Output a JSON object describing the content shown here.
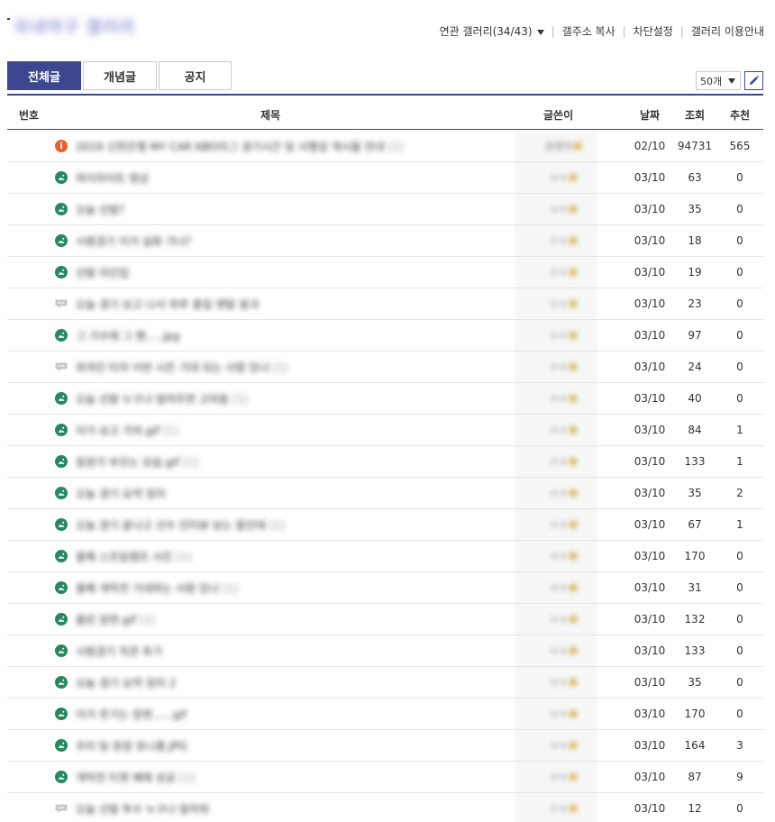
{
  "gallery": {
    "title": "국내야구 갤러리"
  },
  "top_links": {
    "related": "연관 갤러리(34/43)",
    "copy_address": "갤주소 복사",
    "block_settings": "차단설정",
    "guide": "갤러리 이용안내"
  },
  "tabs": [
    {
      "label": "전체글",
      "active": true
    },
    {
      "label": "개념글",
      "active": false
    },
    {
      "label": "공지",
      "active": false
    }
  ],
  "per_page": {
    "label": "50개"
  },
  "write_button": {
    "icon": "pencil-icon"
  },
  "columns": {
    "number": "번호",
    "title": "제목",
    "writer": "글쓴이",
    "date": "날짜",
    "views": "조회",
    "recommend": "추천"
  },
  "colors": {
    "accent": "#3b4890",
    "notice_icon": "#e8602c",
    "image_icon": "#27885e",
    "text_icon": "#c8c8c8"
  },
  "rows": [
    {
      "icon": "notice",
      "title": "2019 신한은행 MY CAR KBO리그 경기시간 및 사행성 게시물 안내",
      "tail": "[1]",
      "writer": "운영자",
      "date": "02/10",
      "views": "94731",
      "recommend": "565"
    },
    {
      "icon": "image",
      "title": "하이라이트 영상",
      "tail": "",
      "writer": "ㅇㅇ",
      "date": "03/10",
      "views": "63",
      "recommend": "0"
    },
    {
      "icon": "image",
      "title": "오늘 선발?",
      "tail": "",
      "writer": "ㅇㅇ",
      "date": "03/10",
      "views": "35",
      "recommend": "0"
    },
    {
      "icon": "image",
      "title": "시범경기 이거 실화 가냐?",
      "tail": "",
      "writer": "ㅇㅇ",
      "date": "03/10",
      "views": "18",
      "recommend": "0"
    },
    {
      "icon": "image",
      "title": "선발 라인업",
      "tail": "",
      "writer": "ㅇㅇ",
      "date": "03/10",
      "views": "19",
      "recommend": "0"
    },
    {
      "icon": "text",
      "title": "오늘 경기 보고 나서 하루 종일 멘탈 붕괴",
      "tail": "",
      "writer": "ㅇㅇ",
      "date": "03/10",
      "views": "23",
      "recommend": "0"
    },
    {
      "icon": "image",
      "title": "그 가수에 그 팬.....jpg",
      "tail": "",
      "writer": "ㅇㅇ",
      "date": "03/10",
      "views": "97",
      "recommend": "0"
    },
    {
      "icon": "text",
      "title": "외국인 타자 이번 시즌 기대 되는 사람 있냐",
      "tail": "[1]",
      "writer": "ㅇㅇ",
      "date": "03/10",
      "views": "24",
      "recommend": "0"
    },
    {
      "icon": "image",
      "title": "오늘 선발 누구냐 알려주면 고마움",
      "tail": "[1]",
      "writer": "ㅇㅇ",
      "date": "03/10",
      "views": "40",
      "recommend": "0"
    },
    {
      "icon": "image",
      "title": "이거 보고 가라.gif",
      "tail": "[1]",
      "writer": "ㅇㅇ",
      "date": "03/10",
      "views": "84",
      "recommend": "1"
    },
    {
      "icon": "image",
      "title": "응원가 부르는 모습.gif",
      "tail": "[1]",
      "writer": "ㅇㅇ",
      "date": "03/10",
      "views": "133",
      "recommend": "1"
    },
    {
      "icon": "image",
      "title": "오늘 경기 요약 정리",
      "tail": "",
      "writer": "ㅇㅇ",
      "date": "03/10",
      "views": "35",
      "recommend": "2"
    },
    {
      "icon": "image",
      "title": "오늘 경기 끝나고 선수 인터뷰 보는 중인데",
      "tail": "[1]",
      "writer": "ㅇㅇ",
      "date": "03/10",
      "views": "67",
      "recommend": "1"
    },
    {
      "icon": "image",
      "title": "올해 스프링캠프 사진",
      "tail": "[1]",
      "writer": "ㅇㅇ",
      "date": "03/10",
      "views": "170",
      "recommend": "0"
    },
    {
      "icon": "image",
      "title": "올해 개막전 기대하는 사람 있냐",
      "tail": "[1]",
      "writer": "ㅇㅇ",
      "date": "03/10",
      "views": "31",
      "recommend": "0"
    },
    {
      "icon": "image",
      "title": "홈런 장면.gif",
      "tail": "[1]",
      "writer": "ㅇㅇ",
      "date": "03/10",
      "views": "132",
      "recommend": "0"
    },
    {
      "icon": "image",
      "title": "시범경기 직관 후기",
      "tail": "",
      "writer": "ㅇㅇ",
      "date": "03/10",
      "views": "133",
      "recommend": "0"
    },
    {
      "icon": "image",
      "title": "오늘 경기 요약 정리 2",
      "tail": "",
      "writer": "ㅇㅇ",
      "date": "03/10",
      "views": "35",
      "recommend": "0"
    },
    {
      "icon": "image",
      "title": "이거 웃기는 장면......gif",
      "tail": "",
      "writer": "ㅇㅇ",
      "date": "03/10",
      "views": "170",
      "recommend": "0"
    },
    {
      "icon": "image",
      "title": "우리 팀 원정 유니폼.JPG",
      "tail": "",
      "writer": "ㅇㅇ",
      "date": "03/10",
      "views": "164",
      "recommend": "3"
    },
    {
      "icon": "image",
      "title": "개막전 티켓 예매 성공",
      "tail": "[1]",
      "writer": "ㅇㅇ",
      "date": "03/10",
      "views": "87",
      "recommend": "9"
    },
    {
      "icon": "text",
      "title": "오늘 선발 투수 누구냐 알려줘",
      "tail": "",
      "writer": "ㅇㅇ",
      "date": "03/10",
      "views": "12",
      "recommend": "0"
    }
  ]
}
